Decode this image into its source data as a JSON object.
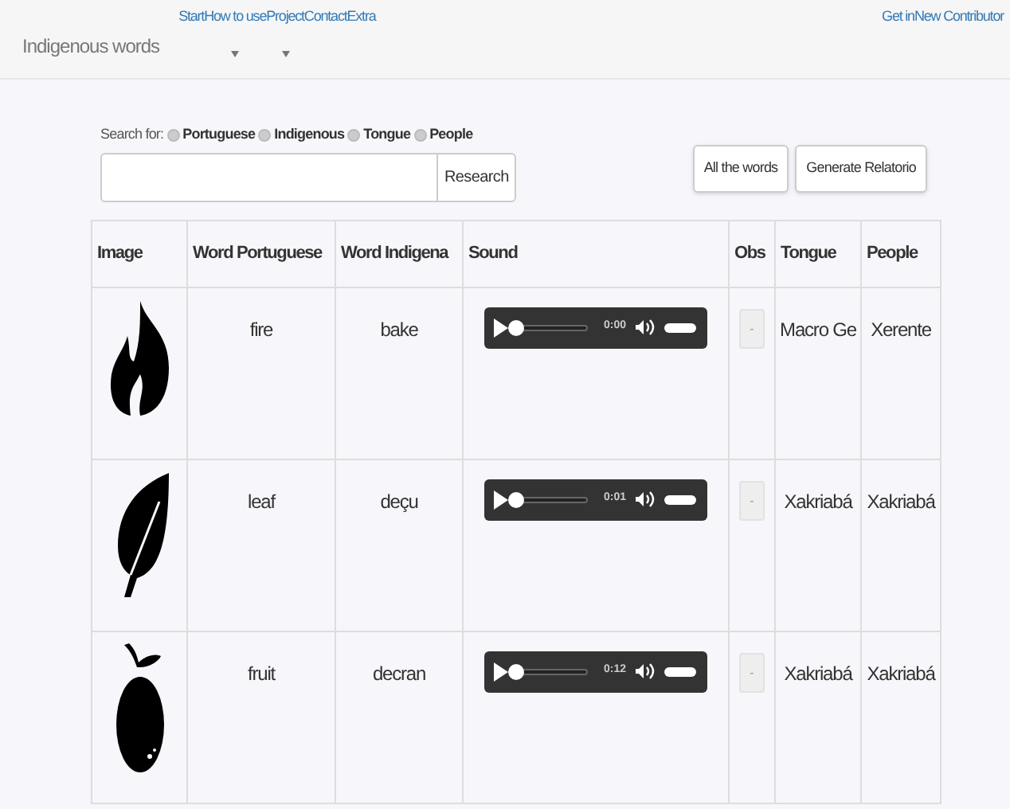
{
  "navbar": {
    "brand": "Indigenous words",
    "links": [
      {
        "label": "Start",
        "dropdown": false
      },
      {
        "label": "How to use",
        "dropdown": true
      },
      {
        "label": "Project",
        "dropdown": true
      },
      {
        "label": "Contact",
        "dropdown": false
      },
      {
        "label": "Extra",
        "dropdown": false
      }
    ],
    "right_links": [
      "Get in",
      "New Contributor"
    ]
  },
  "search": {
    "label": "Search for:",
    "options": [
      {
        "label": "Portuguese",
        "selected": false
      },
      {
        "label": "Indigenous",
        "selected": false
      },
      {
        "label": "Tongue",
        "selected": false
      },
      {
        "label": "People",
        "selected": false
      }
    ],
    "button": "Research"
  },
  "buttons": [
    "All the words",
    "Generate Relatorio"
  ],
  "table": {
    "columns": [
      "Image",
      "Word Portuguese",
      "Word Indigena",
      "Sound",
      "Obs",
      "Tongue",
      "People"
    ],
    "rows": [
      {
        "kind": "flame",
        "portuguese": "fire",
        "indigena": "bake",
        "sound": {
          "time": "0:00",
          "level": 0
        },
        "obs": "-",
        "tongue": "Macro Ge",
        "people": "Xerente"
      },
      {
        "kind": "leaf",
        "portuguese": "leaf",
        "indigena": "deçu",
        "sound": {
          "time": "0:01",
          "level": 0
        },
        "obs": "-",
        "tongue": "Xakriabá",
        "people": "Xakriabá"
      },
      {
        "kind": "fruit",
        "portuguese": "fruit",
        "indigena": "decran",
        "sound": {
          "time": "0:12",
          "level": 0
        },
        "obs": "-",
        "tongue": "Xakriabá",
        "people": "Xakriabá"
      }
    ]
  }
}
